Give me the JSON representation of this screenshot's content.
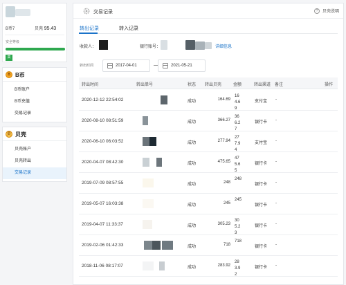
{
  "account": {
    "bcoin_label": "B币",
    "bcoin_value": "7",
    "shell_label": "贝壳",
    "shell_value": "95.43",
    "security_label": "安全等级",
    "security_level": 1.0,
    "security_badge": "高",
    "colors": {
      "security": "#2fa84f"
    }
  },
  "sidebar": {
    "bcoin": {
      "icon": "coin-icon",
      "icon_glyph": "B",
      "title": "B币",
      "items": [
        {
          "label": "B币账户"
        },
        {
          "label": "B币充值"
        },
        {
          "label": "交易记录"
        }
      ]
    },
    "shell": {
      "icon": "shell-icon",
      "icon_glyph": "贝",
      "title": "贝壳",
      "items": [
        {
          "label": "贝壳账户"
        },
        {
          "label": "贝壳转出"
        },
        {
          "label": "交易记录",
          "active": true
        }
      ]
    }
  },
  "main": {
    "title": "交易记录",
    "help": "贝壳说明",
    "tabs": [
      {
        "label": "转出记录",
        "active": true
      },
      {
        "label": "转入记录",
        "active": false
      }
    ],
    "filters": {
      "recipient_label": "收款人：",
      "bank_label": "银行账号：",
      "detail_link": "详细信息",
      "time_label": "转出时间",
      "start_date": "2017-04-01",
      "end_date": "2021-05-21"
    },
    "table": {
      "headers": [
        "转出时间",
        "转出单号",
        "状态",
        "转出贝壳",
        "金额",
        "转出渠道",
        "备注",
        "操作"
      ],
      "rows": [
        {
          "time": "2020-12-12 22:54:02",
          "status": "成功",
          "amount": "164.69",
          "money": "164.69",
          "channel": "支付宝",
          "note": "-"
        },
        {
          "time": "2020-08-10 08:51:59",
          "status": "成功",
          "amount": "366.27",
          "money": "366.27",
          "channel": "银行卡",
          "note": "-"
        },
        {
          "time": "2020-06-10 06:03:52",
          "status": "成功",
          "amount": "277.94",
          "money": "277.94",
          "channel": "支付宝",
          "note": "-"
        },
        {
          "time": "2020-04-07 08:42:30",
          "status": "成功",
          "amount": "475.65",
          "money": "475.65",
          "channel": "银行卡",
          "note": "-"
        },
        {
          "time": "2019-07-09 08:57:55",
          "status": "成功",
          "amount": "248",
          "money": "248",
          "channel": "银行卡",
          "note": "-"
        },
        {
          "time": "2019-05-07 16:03:38",
          "status": "成功",
          "amount": "245",
          "money": "245",
          "channel": "银行卡",
          "note": "-"
        },
        {
          "time": "2019-04-07 11:33:37",
          "status": "成功",
          "amount": "305.23",
          "money": "305.23",
          "channel": "银行卡",
          "note": "-"
        },
        {
          "time": "2019-02-06 01:42:33",
          "status": "成功",
          "amount": "718",
          "money": "718",
          "channel": "银行卡",
          "note": "-"
        },
        {
          "time": "2018-11-06 08:17:07",
          "status": "成功",
          "amount": "283.92",
          "money": "283.92",
          "channel": "银行卡",
          "note": "-"
        }
      ]
    }
  }
}
